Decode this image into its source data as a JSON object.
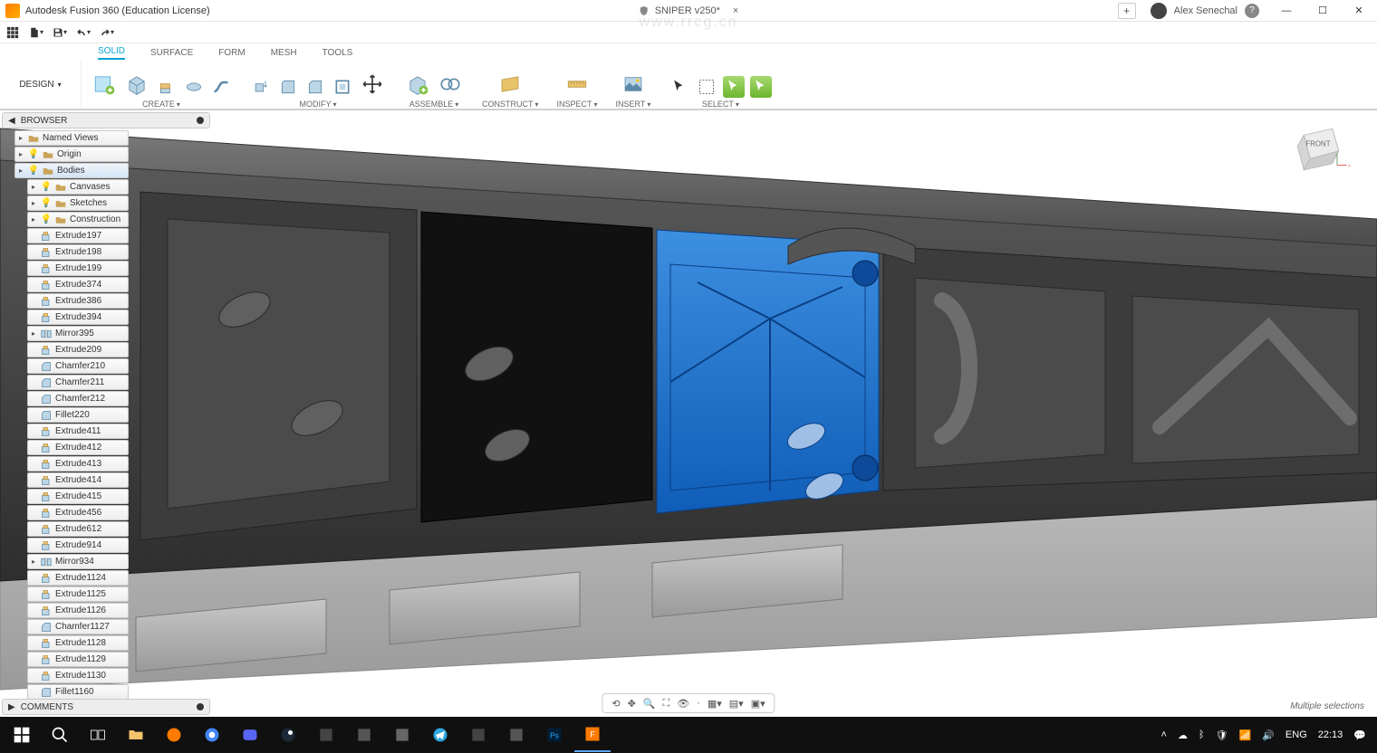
{
  "app": {
    "title": "Autodesk Fusion 360 (Education License)",
    "user": "Alex Senechal"
  },
  "document": {
    "name": "SNIPER v250*"
  },
  "watermark": "www.rrcg.cn",
  "quickbar": {
    "items": [
      "grid",
      "file",
      "save",
      "undo",
      "redo"
    ]
  },
  "worktabs": [
    "SOLID",
    "SURFACE",
    "FORM",
    "MESH",
    "TOOLS"
  ],
  "design_btn": "DESIGN",
  "ribbon": {
    "create": "CREATE",
    "modify": "MODIFY",
    "assemble": "ASSEMBLE",
    "construct": "CONSTRUCT",
    "inspect": "INSPECT",
    "insert": "INSERT",
    "select": "SELECT"
  },
  "browser": {
    "header": "BROWSER",
    "top_nodes": [
      {
        "label": "Named Views",
        "icon": "folder",
        "exp": true,
        "indent": 1
      },
      {
        "label": "Origin",
        "icon": "folder",
        "bulb": true,
        "exp": true,
        "indent": 1
      },
      {
        "label": "Bodies",
        "icon": "folder",
        "bulb": true,
        "exp": true,
        "indent": 1,
        "hl": true
      },
      {
        "label": "Canvases",
        "icon": "folder",
        "bulb": true,
        "exp": true,
        "indent": 2
      },
      {
        "label": "Sketches",
        "icon": "folder",
        "bulb": true,
        "exp": true,
        "indent": 2
      },
      {
        "label": "Construction",
        "icon": "folder",
        "bulb": true,
        "exp": true,
        "indent": 2
      }
    ],
    "features": [
      {
        "label": "Extrude197",
        "icon": "extrude"
      },
      {
        "label": "Extrude198",
        "icon": "extrude"
      },
      {
        "label": "Extrude199",
        "icon": "extrude"
      },
      {
        "label": "Extrude374",
        "icon": "extrude"
      },
      {
        "label": "Extrude386",
        "icon": "extrude"
      },
      {
        "label": "Extrude394",
        "icon": "extrude"
      },
      {
        "label": "Mirror395",
        "icon": "mirror",
        "exp": true
      },
      {
        "label": "Extrude209",
        "icon": "extrude"
      },
      {
        "label": "Chamfer210",
        "icon": "chamfer"
      },
      {
        "label": "Chamfer211",
        "icon": "chamfer"
      },
      {
        "label": "Chamfer212",
        "icon": "chamfer"
      },
      {
        "label": "Fillet220",
        "icon": "fillet"
      },
      {
        "label": "Extrude411",
        "icon": "extrude"
      },
      {
        "label": "Extrude412",
        "icon": "extrude"
      },
      {
        "label": "Extrude413",
        "icon": "extrude"
      },
      {
        "label": "Extrude414",
        "icon": "extrude"
      },
      {
        "label": "Extrude415",
        "icon": "extrude"
      },
      {
        "label": "Extrude456",
        "icon": "extrude"
      },
      {
        "label": "Extrude612",
        "icon": "extrude"
      },
      {
        "label": "Extrude914",
        "icon": "extrude"
      },
      {
        "label": "Mirror934",
        "icon": "mirror",
        "exp": true
      },
      {
        "label": "Extrude1124",
        "icon": "extrude"
      },
      {
        "label": "Extrude1125",
        "icon": "extrude"
      },
      {
        "label": "Extrude1126",
        "icon": "extrude"
      },
      {
        "label": "Chamfer1127",
        "icon": "chamfer"
      },
      {
        "label": "Extrude1128",
        "icon": "extrude"
      },
      {
        "label": "Extrude1129",
        "icon": "extrude"
      },
      {
        "label": "Extrude1130",
        "icon": "extrude"
      },
      {
        "label": "Fillet1160",
        "icon": "fillet"
      }
    ]
  },
  "comments": "COMMENTS",
  "status": "Multiple selections",
  "viewcube": {
    "face": "FRONT"
  },
  "taskbar": {
    "lang": "ENG",
    "time": "22:13"
  }
}
